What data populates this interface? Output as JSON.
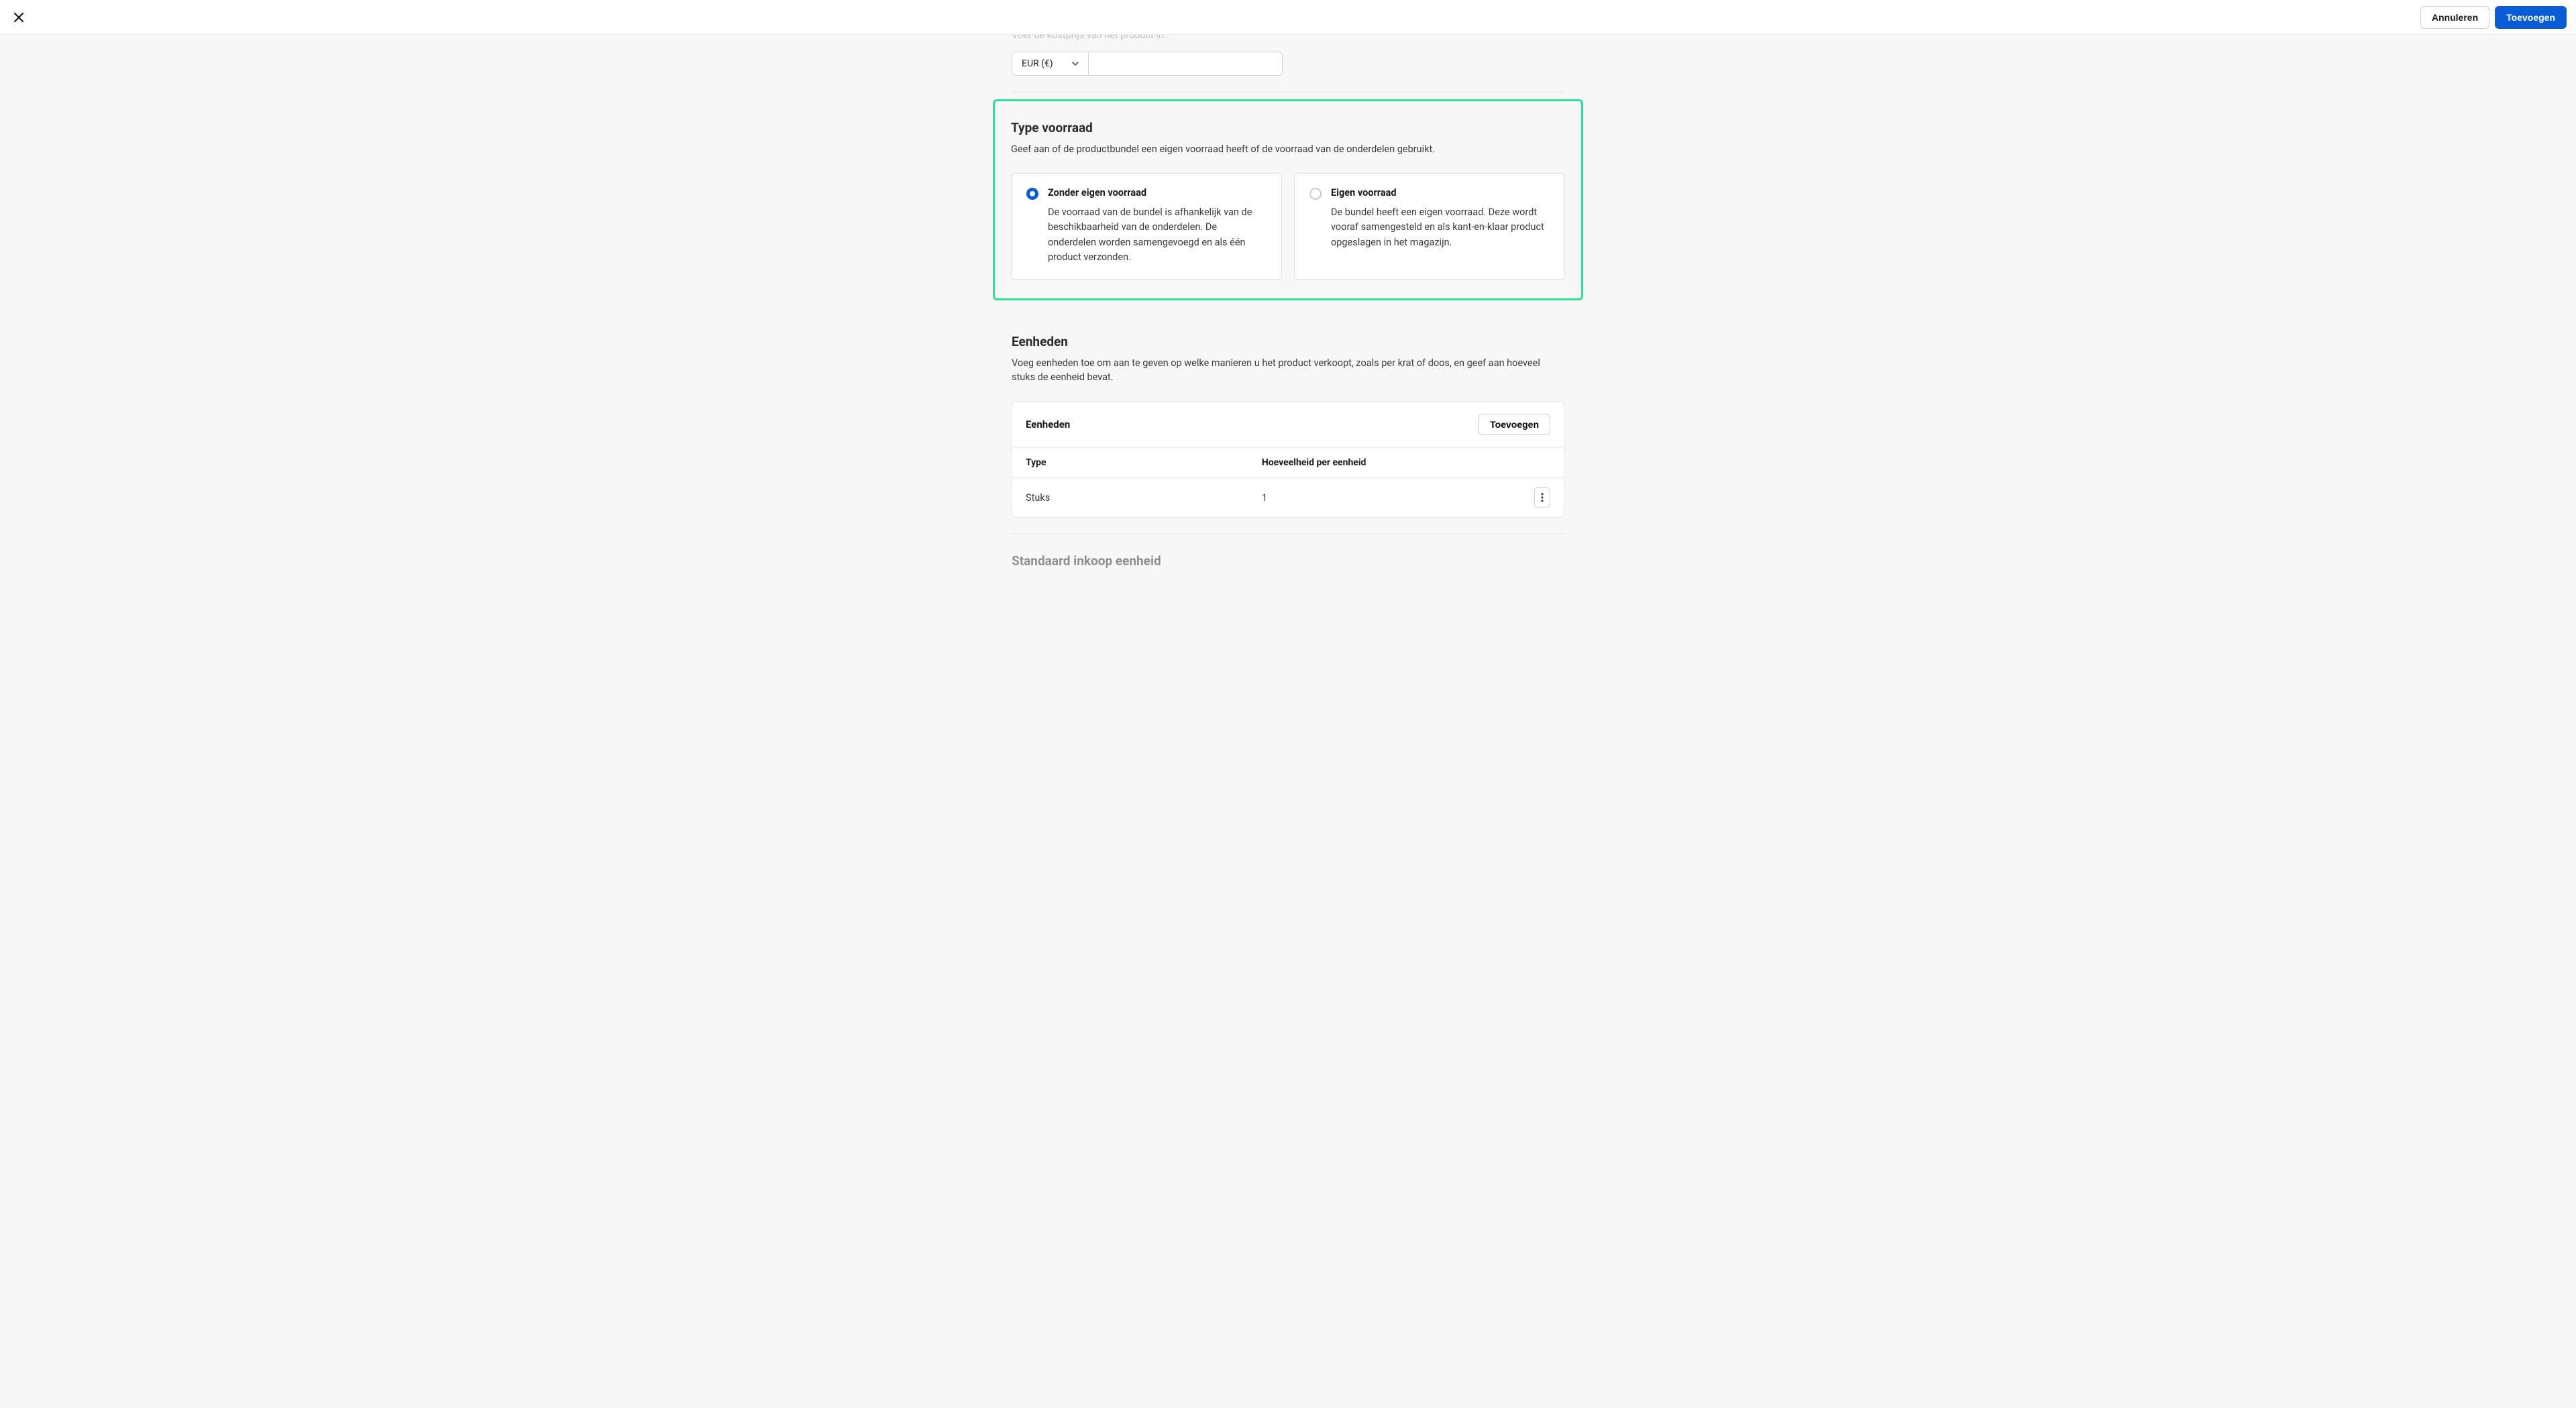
{
  "header": {
    "cancel_label": "Annuleren",
    "add_label": "Toevoegen"
  },
  "cost_price": {
    "partial_text": "Voer de kostprijs van het product in.",
    "currency_label": "EUR (€)",
    "value": ""
  },
  "stock_type": {
    "title": "Type voorraad",
    "description": "Geef aan of de productbundel een eigen voorraad heeft of de voorraad van de onderdelen gebruikt.",
    "options": [
      {
        "title": "Zonder eigen voorraad",
        "description": "De voorraad van de bundel is afhankelijk van de beschikbaarheid van de onderdelen. De onderdelen worden samengevoegd en als één product verzonden.",
        "selected": true
      },
      {
        "title": "Eigen voorraad",
        "description": "De bundel heeft een eigen voorraad. Deze wordt vooraf samengesteld en als kant-en-klaar product opgeslagen in het magazijn.",
        "selected": false
      }
    ]
  },
  "units": {
    "title": "Eenheden",
    "description": "Voeg eenheden toe om aan te geven op welke manieren u het product verkoopt, zoals per krat of doos, en geef aan hoeveel stuks de eenheid bevat.",
    "card_title": "Eenheden",
    "add_label": "Toevoegen",
    "columns": {
      "type": "Type",
      "quantity": "Hoeveelheid per eenheid"
    },
    "rows": [
      {
        "type": "Stuks",
        "quantity": "1"
      }
    ]
  },
  "next_section": {
    "title_partial": "Standaard inkoop eenheid"
  }
}
